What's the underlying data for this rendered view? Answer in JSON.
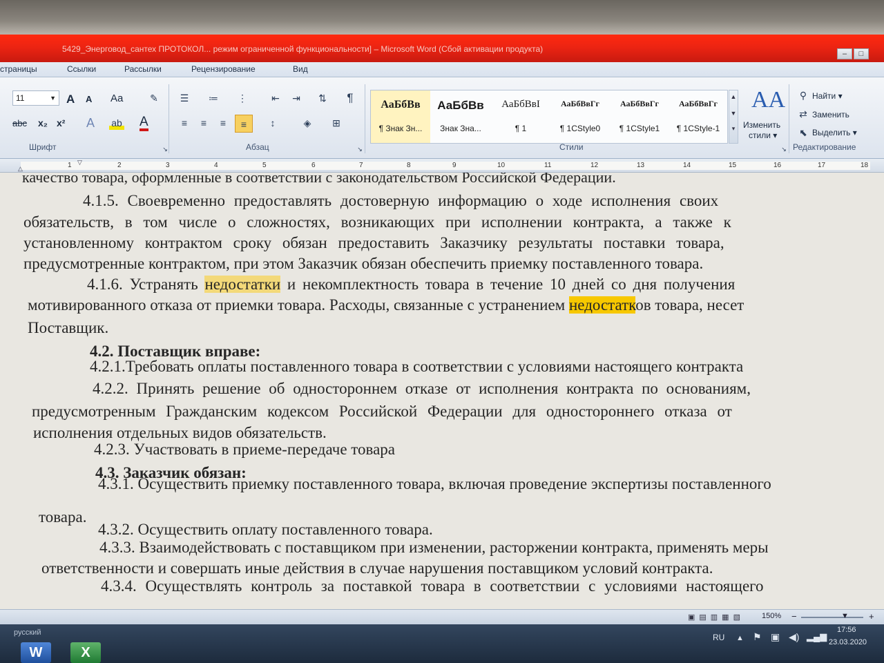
{
  "window": {
    "title": "5429_Энерговод_сантех ПРОТОКОЛ... режим ограниченной функциональности] – Microsoft Word (Сбой активации продукта)",
    "min_icon": "minimize-icon",
    "max_icon": "maximize-icon"
  },
  "tabs": [
    "страницы",
    "Ссылки",
    "Рассылки",
    "Рецензирование",
    "Вид"
  ],
  "ribbon": {
    "font_size": "11",
    "grow_font": "A",
    "shrink_font": "A",
    "case_label": "Aa",
    "strike_label": "abc",
    "sub_label": "x₂",
    "sup_label": "x²",
    "font_color_label": "A",
    "groups": {
      "font": "Шрифт",
      "paragraph": "Абзац",
      "styles": "Стили",
      "editing": "Редактирование"
    },
    "styles": [
      {
        "sample": "АаБбВв",
        "name": "¶ Знак Зн..."
      },
      {
        "sample": "АаБбВв",
        "name": "Знак Зна..."
      },
      {
        "sample": "АаБбВвI",
        "name": "¶ 1"
      },
      {
        "sample": "АаБбВвГг",
        "name": "¶ 1CStyle0"
      },
      {
        "sample": "АаБбВвГг",
        "name": "¶ 1CStyle1"
      },
      {
        "sample": "АаБбВвГг",
        "name": "¶ 1CStyle-1"
      }
    ],
    "change_styles_icon": "AA",
    "change_styles": [
      "Изменить",
      "стили ▾"
    ],
    "find": "Найти ▾",
    "replace": "Заменить",
    "select": "Выделить ▾"
  },
  "ruler": [
    "1",
    "2",
    "3",
    "4",
    "5",
    "6",
    "7",
    "8",
    "9",
    "10",
    "11",
    "12",
    "13",
    "14",
    "15",
    "16",
    "17",
    "18"
  ],
  "doc": {
    "l0": "качество товара, оформленные в соответствии с законодательством Российской Федерации.",
    "l1": "4.1.5. Своевременно предоставлять достоверную информацию о ходе исполнения своих",
    "l2": "обязательств, в том числе о сложностях, возникающих при исполнении контракта, а также к",
    "l3": "установленному контрактом сроку обязан предоставить Заказчику результаты поставки товара,",
    "l4": "предусмотренные контрактом, при этом Заказчик обязан обеспечить приемку поставленного товара.",
    "l5a": "4.1.6. Устранять ",
    "l5b": "недостатки",
    "l5c": " и некомплектность товара в течение 10 дней со дня получения",
    "l6a": "мотивированного отказа от приемки товара. Расходы, связанные с устранением ",
    "l6b": "недостатк",
    "l6c": "ов товара, несет",
    "l7": "Поставщик.",
    "h42": "4.2. Поставщик вправе:",
    "l9": "4.2.1.Требовать оплаты поставленного товара в соответствии с условиями настоящего контракта",
    "l10": "4.2.2. Принять решение об одностороннем отказе от исполнения контракта по основаниям,",
    "l11": "предусмотренным Гражданским кодексом Российской Федерации для одностороннего отказа от",
    "l12": "исполнения отдельных видов обязательств.",
    "l13": "4.2.3. Участвовать в приеме-передаче товара",
    "h43": "4.3. Заказчик обязан:",
    "l15": "4.3.1. Осуществить приемку поставленного товара, включая проведение экспертизы поставленного",
    "l16": "товара.",
    "l17": "4.3.2.  Осуществить оплату поставленного товара.",
    "l18": "4.3.3. Взаимодействовать с поставщиком при изменении, расторжении контракта, применять меры",
    "l19": "ответственности и совершать иные действия в случае нарушения поставщиком условий контракта.",
    "l20": "4.3.4. Осуществлять контроль за поставкой товара в соответствии с условиями настоящего"
  },
  "status": {
    "zoom": "150%",
    "zoom_out": "−",
    "zoom_in": "+"
  },
  "taskbar": {
    "language_bar": "русский",
    "word_app": "W",
    "excel_app": "X",
    "lang": "RU",
    "time": "17:56",
    "date": "23.03.2020"
  }
}
